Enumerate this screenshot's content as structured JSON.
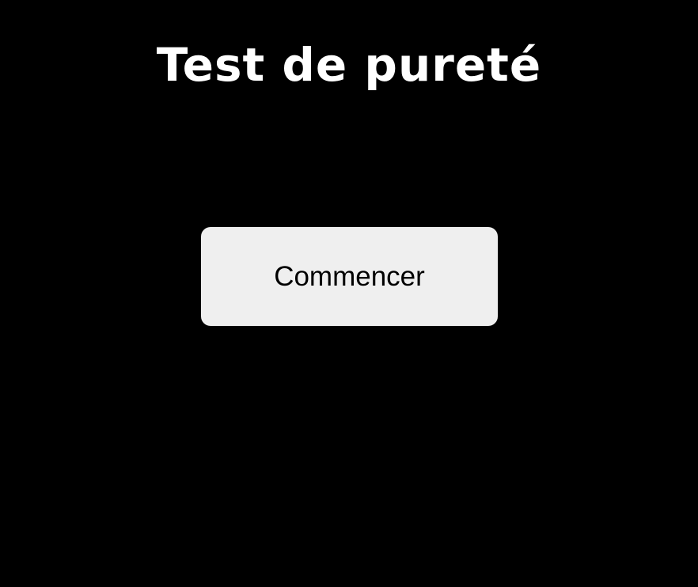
{
  "title": "Test de pureté",
  "start_button": {
    "label": "Commencer"
  },
  "colors": {
    "background": "#000000",
    "title": "#ffffff",
    "button_bg": "#efefef",
    "button_text": "#000000"
  }
}
